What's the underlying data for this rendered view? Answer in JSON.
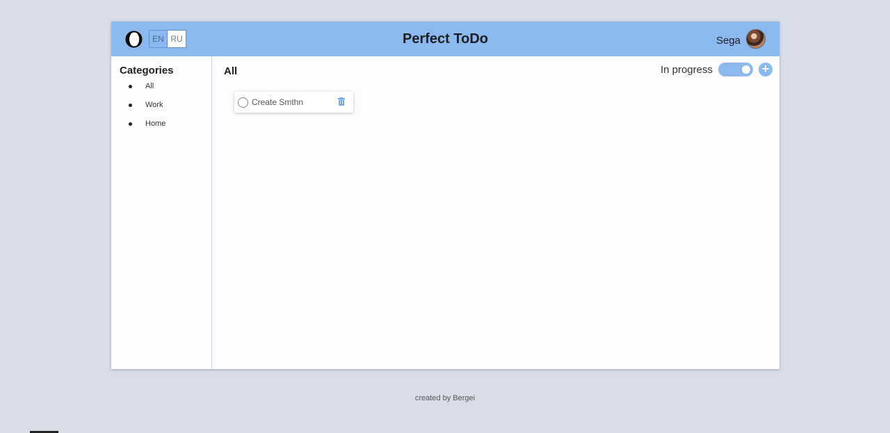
{
  "header": {
    "title": "Perfect ToDo",
    "theme_icon": "moon-icon",
    "languages": [
      "EN",
      "RU"
    ],
    "active_language": "EN",
    "user_name": "Sega"
  },
  "sidebar": {
    "heading": "Categories",
    "items": [
      {
        "label": "All"
      },
      {
        "label": "Work"
      },
      {
        "label": "Home"
      }
    ]
  },
  "main": {
    "heading": "All",
    "filter_label": "In progress",
    "filter_on": true,
    "add_icon": "plus-icon",
    "tasks": [
      {
        "text": "Create Smthn",
        "done": false
      }
    ]
  },
  "footer": {
    "text": "created by Bergei"
  },
  "colors": {
    "accent": "#8ab8ef",
    "background": "#d8dde8"
  }
}
